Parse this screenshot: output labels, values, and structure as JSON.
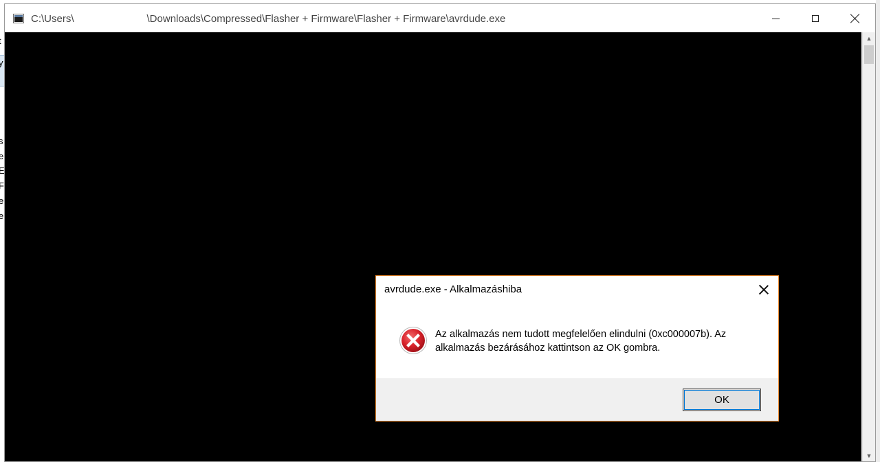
{
  "background_window": {
    "clipped_chars": [
      "t",
      "y",
      "s",
      "e",
      "E",
      "F",
      "e",
      "e"
    ]
  },
  "console_window": {
    "title_prefix": "C:\\Users\\",
    "title_suffix": "\\Downloads\\Compressed\\Flasher + Firmware\\Flasher + Firmware\\avrdude.exe",
    "scroll_up_glyph": "▲",
    "scroll_down_glyph": "▼"
  },
  "dialog": {
    "title": "avrdude.exe - Alkalmazáshiba",
    "message": "Az alkalmazás nem tudott megfelelően elindulni (0xc000007b). Az alkalmazás bezárásához kattintson az OK gombra.",
    "ok_label": "OK",
    "icon": "error-icon"
  },
  "colors": {
    "console_background": "#000000",
    "dialog_border": "#e8872b",
    "error_red": "#d8212a",
    "focus_blue": "#0078d7"
  }
}
